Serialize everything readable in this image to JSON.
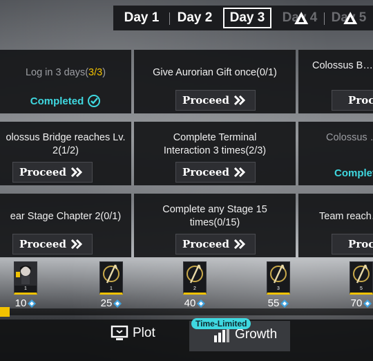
{
  "tabs": [
    {
      "label": "Day 1",
      "state": "normal"
    },
    {
      "label": "Day 2",
      "state": "normal"
    },
    {
      "label": "Day 3",
      "state": "active"
    },
    {
      "label": "Day 4",
      "state": "locked"
    },
    {
      "label": "Day 5",
      "state": "locked"
    }
  ],
  "missions": [
    {
      "title_prefix": "Log in 3 days(",
      "title_progress": "3/3",
      "title_suffix": ")",
      "status": "Completed"
    },
    {
      "title": "Give Aurorian Gift once(0/1)",
      "action": "Proceed"
    },
    {
      "title": "Colossus B… Cafe",
      "action": "Proceed"
    },
    {
      "title": "olossus Bridge reaches Lv. 2(1/2)",
      "action": "Proceed"
    },
    {
      "title": "Complete Terminal Interaction 3 times(2/3)",
      "action": "Proceed"
    },
    {
      "title": "Colossus … Prisms",
      "status": "Complete"
    },
    {
      "title": "ear Stage Chapter 2(0/1)",
      "action": "Proceed"
    },
    {
      "title": "Complete any Stage 15 times(0/15)",
      "action": "Proceed"
    },
    {
      "title": "Team reach…",
      "action": "Proceed"
    }
  ],
  "rewards": [
    {
      "points": "10",
      "count": "1",
      "icon": "character-portrait-icon"
    },
    {
      "points": "25",
      "count": "1",
      "icon": "gold-spear-icon"
    },
    {
      "points": "40",
      "count": "2",
      "icon": "gold-spear-icon"
    },
    {
      "points": "55",
      "count": "3",
      "icon": "gold-spear-icon"
    },
    {
      "points": "70",
      "count": "5",
      "icon": "gold-spear-icon"
    }
  ],
  "progress": {
    "fraction": 0.0
  },
  "nav": {
    "plot_label": "Plot",
    "growth_label": "Growth",
    "growth_badge": "Time-Limited"
  },
  "colors": {
    "accent": "#f2c200",
    "complete": "#3fd8e0"
  }
}
